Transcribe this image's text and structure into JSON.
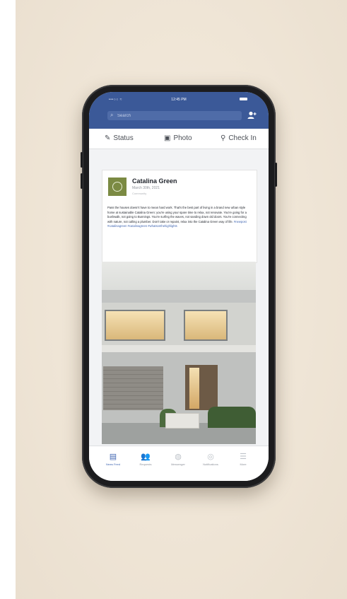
{
  "status_bar": {
    "signal": "•••○○ ≈",
    "time": "12:45 PM"
  },
  "search": {
    "placeholder": "Search"
  },
  "actions": [
    {
      "label": "Status",
      "icon": "edit-icon"
    },
    {
      "label": "Photo",
      "icon": "camera-icon"
    },
    {
      "label": "Check In",
      "icon": "location-pin-icon"
    }
  ],
  "post": {
    "author": "Catalina Green",
    "date": "March 30th, 2021",
    "subtitle": "Community",
    "body": "Pass the houses doesn't have to mean hard work. That's the best part of living in a brand new urban style home at sustainable Catalina Green: you're using your spare time to relax, not renovate. You're going for a bushwalk, not going to Bunnings. You're surfing the waves, not sanding down old doors. You're connecting with nature, not calling a plumber. Don't take or repaint, relax into the Catalina Green way of life.",
    "link": "#newpost #catalinagreen #catalinagreen #whatsonthehighlights",
    "brand_color": "#7b8a43"
  },
  "tabs": [
    {
      "label": "News Feed",
      "icon": "news-feed-icon",
      "active": true
    },
    {
      "label": "Requests",
      "icon": "friends-icon",
      "active": false
    },
    {
      "label": "Messenger",
      "icon": "messenger-icon",
      "active": false
    },
    {
      "label": "Notifications",
      "icon": "globe-icon",
      "active": false
    },
    {
      "label": "More",
      "icon": "menu-icon",
      "active": false
    }
  ],
  "colors": {
    "header": "#3b5998",
    "accent": "#4267b2"
  }
}
